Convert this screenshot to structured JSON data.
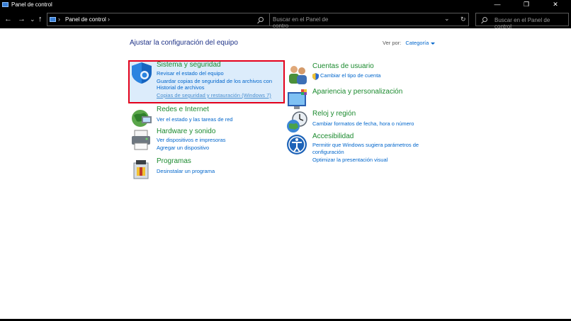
{
  "window": {
    "title": "Panel de control",
    "minimize_glyph": "—",
    "restore_glyph": "❐",
    "close_glyph": "✕"
  },
  "nav": {
    "back_glyph": "←",
    "forward_glyph": "→",
    "recent_glyph": "⌄",
    "up_glyph": "↑",
    "chevron_glyph": "›",
    "breadcrumb": "Panel de control",
    "dropdown_glyph": "⌄",
    "refresh_glyph": "↻",
    "search_placeholder_1": "Buscar en el Panel de contro",
    "search_placeholder_2": "Buscar en el Panel de control"
  },
  "main": {
    "heading": "Ajustar la configuración del equipo",
    "view_by_label": "Ver por:",
    "view_by_value": "Categoría"
  },
  "categories": [
    {
      "title": "Sistema y seguridad",
      "links": [
        "Revisar el estado del equipo",
        "Guardar copias de seguridad de los archivos con",
        "Historial de archivos",
        "Copias de seguridad y restauración (Windows 7)"
      ]
    },
    {
      "title": "Redes e Internet",
      "links": [
        "Ver el estado y las tareas de red"
      ]
    },
    {
      "title": "Hardware y sonido",
      "links": [
        "Ver dispositivos e impresoras",
        "Agregar un dispositivo"
      ]
    },
    {
      "title": "Programas",
      "links": [
        "Desinstalar un programa"
      ]
    },
    {
      "title": "Cuentas de usuario",
      "links": [
        "Cambiar el tipo de cuenta"
      ]
    },
    {
      "title": "Apariencia y personalización",
      "links": []
    },
    {
      "title": "Reloj y región",
      "links": [
        "Cambiar formatos de fecha, hora o número"
      ]
    },
    {
      "title": "Accesibilidad",
      "links": [
        "Permitir que Windows sugiera parámetros de",
        "configuración",
        "Optimizar la presentación visual"
      ]
    }
  ],
  "colors": {
    "category_title": "#1b8a2e",
    "link": "#0066cc",
    "heading": "#1e3287",
    "highlight_border": "#e3001b",
    "highlight_fill": "#dcecfb"
  }
}
